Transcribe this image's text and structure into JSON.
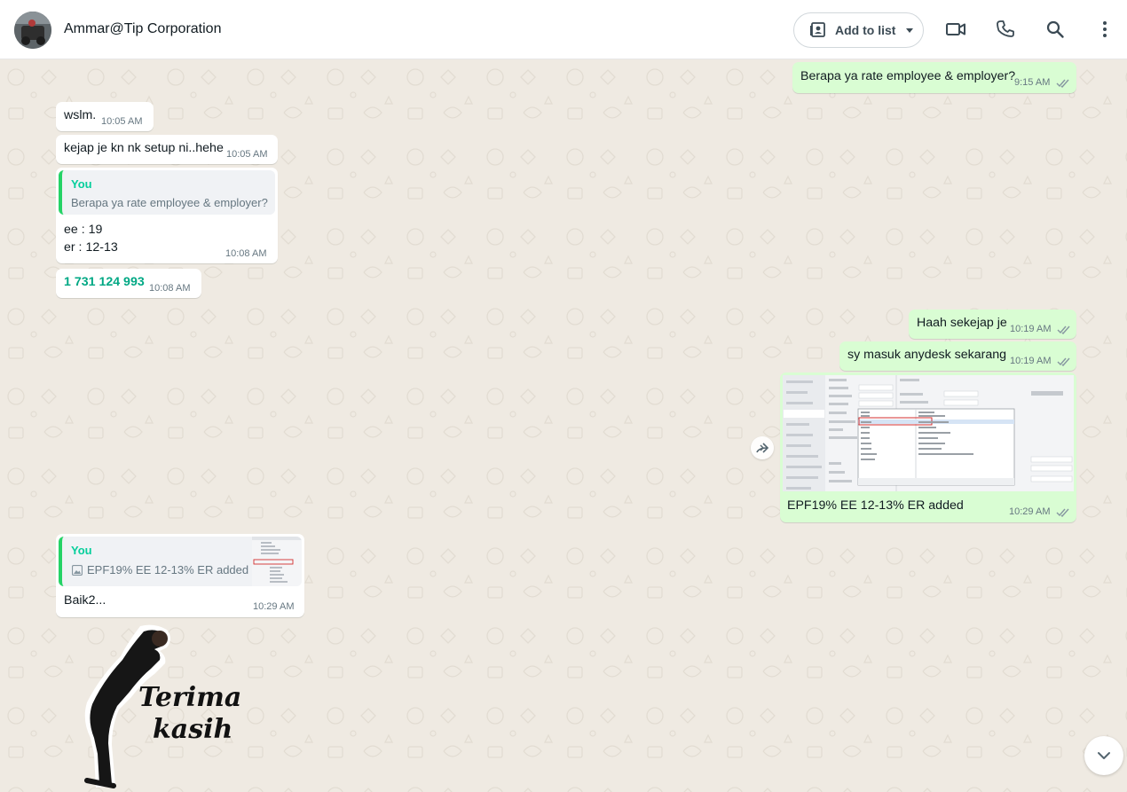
{
  "header": {
    "chat_title": "Ammar@Tip Corporation",
    "add_to_list_label": "Add to list",
    "icons": [
      "contact-list-icon",
      "video-call-icon",
      "voice-call-icon",
      "search-icon",
      "more-options-icon"
    ]
  },
  "messages": [
    {
      "direction": "out",
      "text": "Berapa ya rate employee & employer?",
      "time": "9:15 AM",
      "status": "read"
    },
    {
      "direction": "in",
      "text": "wslm.",
      "time": "10:05 AM"
    },
    {
      "direction": "in",
      "text": "kejap je kn nk setup ni..hehe",
      "time": "10:05 AM"
    },
    {
      "direction": "in",
      "quote_author": "You",
      "quote_text": "Berapa ya rate employee & employer?",
      "line1": "ee : 19",
      "line2": "er : 12-13",
      "time": "10:08 AM"
    },
    {
      "direction": "in",
      "phone": "1 731 124 993",
      "time": "10:08 AM"
    },
    {
      "direction": "out",
      "text": "Haah sekejap je",
      "time": "10:19 AM",
      "status": "read"
    },
    {
      "direction": "out",
      "text": "sy masuk anydesk sekarang",
      "time": "10:19 AM",
      "status": "read"
    },
    {
      "direction": "out",
      "caption": "EPF19% EE 12-13% ER added",
      "time": "10:29 AM",
      "status": "read"
    },
    {
      "direction": "in",
      "quote_author": "You",
      "quote_text": "EPF19% EE 12-13% ER added",
      "text": "Baik2...",
      "time": "10:29 AM"
    },
    {
      "direction": "in",
      "sticker_text_line1": "Terima",
      "sticker_text_line2": "kasih"
    }
  ],
  "colors": {
    "incoming_bubble": "#ffffff",
    "outgoing_bubble": "#d9fdd3",
    "chat_background": "#efeae2",
    "quote_accent": "#25d366",
    "read_ticks": "#53bdeb"
  }
}
